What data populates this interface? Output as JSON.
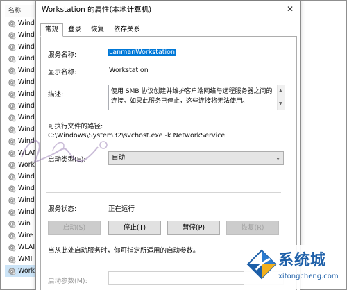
{
  "services_list": {
    "header": "名称",
    "rows": [
      "Wind",
      "Wind",
      "Wind",
      "Wind",
      "Wind",
      "Wind",
      "Wind",
      "Wind",
      "Wind",
      "Wind",
      "Wind",
      "WLAN",
      "Work",
      "Wind",
      "Wind",
      "Wind",
      "Wind",
      "Win",
      "Wire",
      "WLAI",
      "WMI",
      "Work"
    ]
  },
  "dialog": {
    "title": "Workstation 的属性(本地计算机)",
    "close_glyph": "✕",
    "tabs": [
      "常规",
      "登录",
      "恢复",
      "依存关系"
    ],
    "service_name_label": "服务名称:",
    "service_name_value": "LanmanWorkstation",
    "display_name_label": "显示名称:",
    "display_name_value": "Workstation",
    "description_label": "描述:",
    "description_value": "使用 SMB 协议创建并维护客户端网络与远程服务器之间的连接。如果此服务已停止，这些连接将无法使用。",
    "exe_path_label": "可执行文件的路径:",
    "exe_path_value": "C:\\Windows\\System32\\svchost.exe -k NetworkService",
    "startup_type_label": "启动类型(E):",
    "startup_type_value": "自动",
    "status_label": "服务状态:",
    "status_value": "正在运行",
    "buttons": {
      "start": "启动(S)",
      "stop": "停止(T)",
      "pause": "暂停(P)",
      "resume": "恢复(R)"
    },
    "hint": "当从此处启动服务时，你可指定所适用的启动参数。",
    "start_params_label": "启动参数(M):"
  },
  "watermark": {
    "name": "系统城",
    "url": "xitongcheng.com"
  },
  "colors": {
    "selection": "#0078d7",
    "watermark_blue": "#1d5fa8"
  }
}
